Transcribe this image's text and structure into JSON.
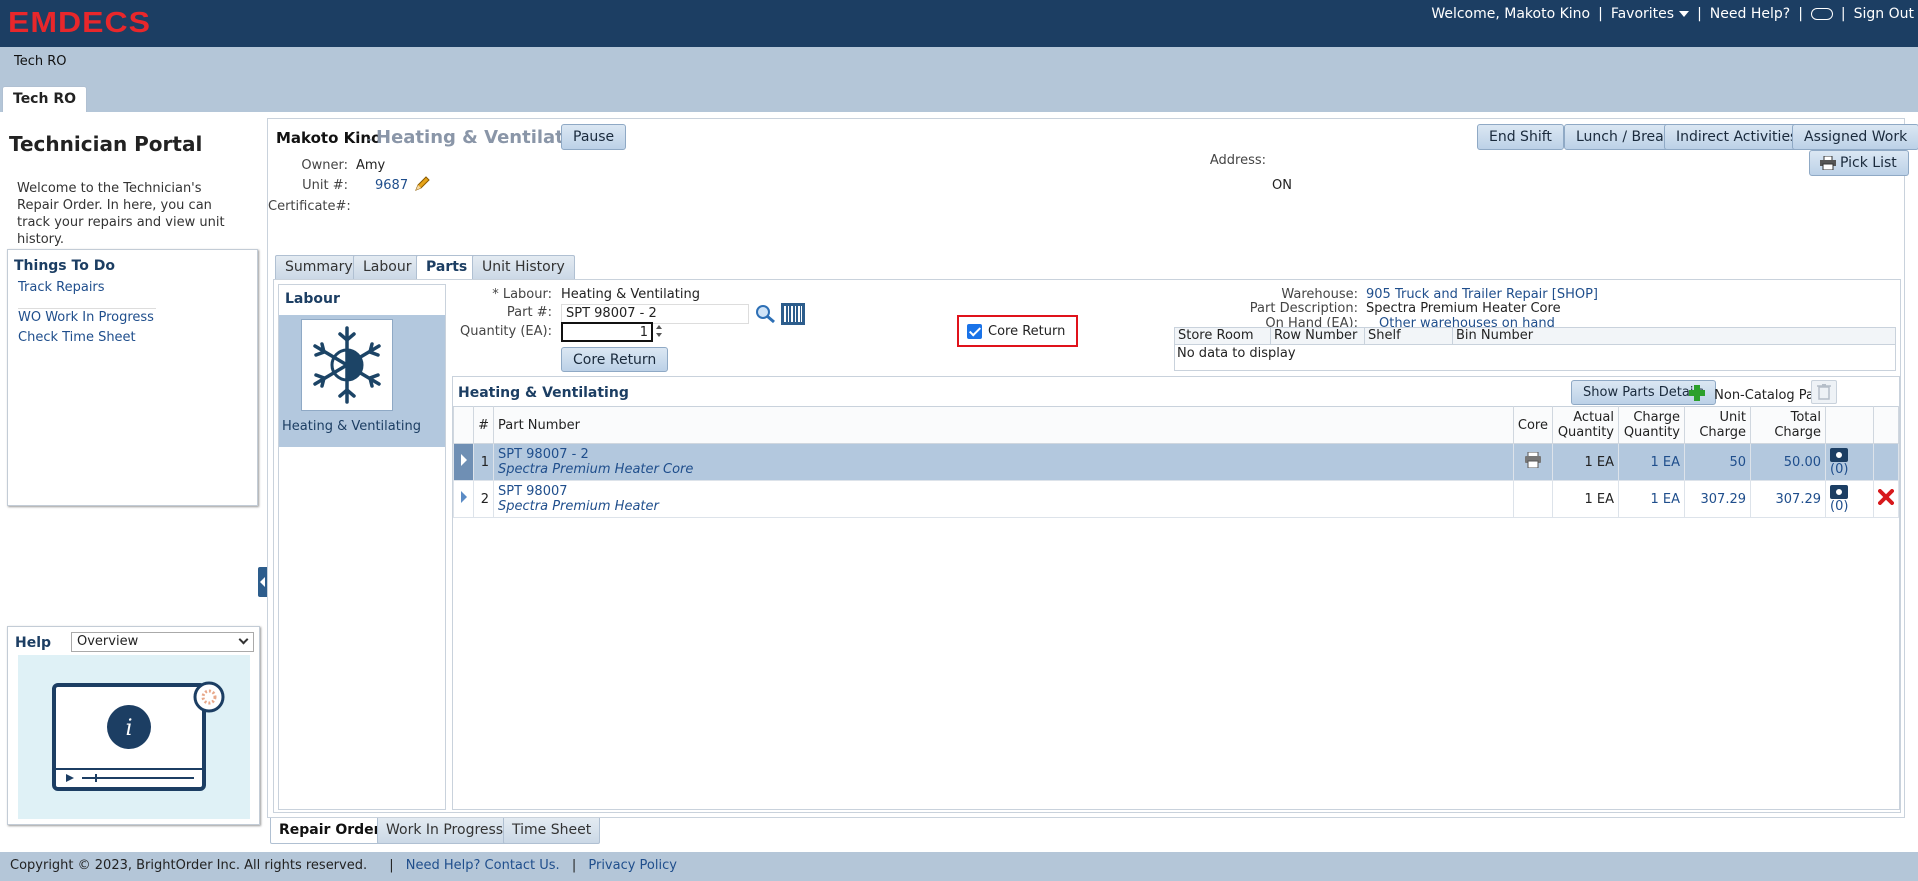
{
  "app": {
    "logo": "EMDECS"
  },
  "topnav": {
    "welcome": "Welcome, Makoto Kino",
    "favorites": "Favorites",
    "need_help": "Need Help?",
    "sign_out": "Sign Out"
  },
  "breadcrumb": "Tech RO",
  "page_tab": "Tech RO",
  "sidebar": {
    "title": "Technician Portal",
    "description": "Welcome to the Technician's Repair Order. In here, you can track your repairs and view unit history.",
    "todo_title": "Things To Do",
    "todo_items": [
      "Track Repairs",
      "WO Work In Progress",
      "Check Time Sheet"
    ],
    "help_title": "Help",
    "help_select_value": "Overview"
  },
  "header": {
    "technician": "Makoto Kino",
    "dash": "-",
    "task": "Heating & Ventilating",
    "pause_label": "Pause",
    "owner_label": "Owner:",
    "owner_value": "Amy",
    "unit_label": "Unit #:",
    "unit_value": "9687",
    "certificate_label": "Certificate#:",
    "address_label": "Address:",
    "address_value": "ON",
    "buttons": [
      "End Shift",
      "Lunch / Break",
      "Indirect Activities",
      "Assigned Work"
    ],
    "pick_list_label": "Pick List"
  },
  "tabs": [
    "Summary",
    "Labour",
    "Parts",
    "Unit History"
  ],
  "active_tab": "Parts",
  "labour_panel": {
    "title": "Labour",
    "card_label": "Heating & Ventilating"
  },
  "part_form": {
    "labour_label": "* Labour:",
    "labour_value": "Heating & Ventilating",
    "part_label": "Part #:",
    "part_value": "SPT 98007 - 2",
    "quantity_label": "Quantity (EA):",
    "quantity_value": "1",
    "core_return_checkbox_label": "Core Return",
    "core_return_checked": true,
    "core_return_button": "Core Return"
  },
  "stock_info": {
    "warehouse_label": "Warehouse:",
    "warehouse_value": "905 Truck and Trailer Repair [SHOP]",
    "part_desc_label": "Part Description:",
    "part_desc_value": "Spectra Premium Heater Core",
    "on_hand_label": "On Hand (EA):",
    "on_hand_link": "Other warehouses on hand",
    "table_headers": [
      "Store Room",
      "Row Number",
      "Shelf",
      "Bin Number"
    ],
    "empty_text": "No data to display"
  },
  "parts_grid": {
    "title": "Heating & Ventilating",
    "show_details_label": "Show Parts Details",
    "non_catalog_label": "Non-Catalog Part",
    "headers": {
      "num": "#",
      "part_number": "Part Number",
      "core": "Core",
      "actual_qty": "Actual Quantity",
      "charge_qty": "Charge Quantity",
      "unit_charge": "Unit Charge",
      "total_charge": "Total Charge"
    },
    "rows": [
      {
        "num": "1",
        "part_number": "SPT 98007 - 2",
        "description": "Spectra Premium Heater Core",
        "actual_qty": "1 EA",
        "charge_qty": "1 EA",
        "unit_charge": "50",
        "total_charge": "50.00",
        "photos": "(0)"
      },
      {
        "num": "2",
        "part_number": "SPT 98007",
        "description": "Spectra Premium Heater",
        "actual_qty": "1 EA",
        "charge_qty": "1 EA",
        "unit_charge": "307.29",
        "total_charge": "307.29",
        "photos": "(0)"
      }
    ]
  },
  "bottom_tabs": [
    "Repair Order",
    "Work In Progress",
    "Time Sheet"
  ],
  "footer": {
    "copyright": "Copyright © 2023, BrightOrder Inc. All rights reserved.",
    "help_link": "Need Help? Contact Us.",
    "privacy_link": "Privacy Policy"
  },
  "colors": {
    "topbar": "#1c3e63",
    "logo": "#e8272b",
    "accent": "#1f4e8c",
    "highlight": "#e0121b"
  }
}
